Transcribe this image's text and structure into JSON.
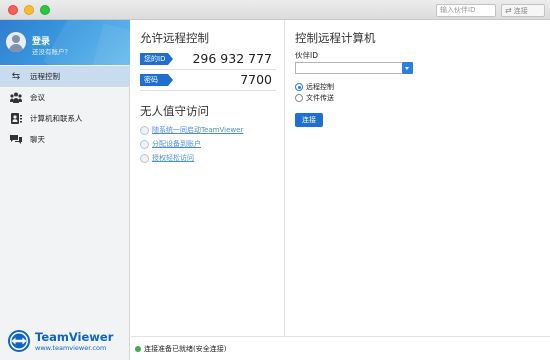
{
  "titlebar": {
    "partner_placeholder": "输入伙伴ID",
    "connect_label": "连接"
  },
  "sidebar": {
    "login_title": "登录",
    "login_subtitle": "还没有账户？",
    "items": [
      {
        "label": "远程控制",
        "icon": "arrows-icon",
        "active": true
      },
      {
        "label": "会议",
        "icon": "meeting-icon",
        "active": false
      },
      {
        "label": "计算机和联系人",
        "icon": "contacts-icon",
        "active": false
      },
      {
        "label": "聊天",
        "icon": "chat-icon",
        "active": false
      }
    ],
    "brand_name": "TeamViewer",
    "brand_url": "www.teamviewer.com"
  },
  "allow": {
    "title": "允许远程控制",
    "id_label": "您的ID",
    "id_value": "296 932 777",
    "pw_label": "密码",
    "pw_value": "7700"
  },
  "unattended": {
    "title": "无人值守访问",
    "links": [
      "随系统一同启动TeamViewer",
      "分配设备到账户",
      "授权轻松访问"
    ]
  },
  "control": {
    "title": "控制远程计算机",
    "partner_label": "伙伴ID",
    "partner_value": "",
    "options": [
      "远程控制",
      "文件传送"
    ],
    "selected_option": "远程控制",
    "connect_label": "连接"
  },
  "status": {
    "text": "连接准备已就绪(安全连接)",
    "color": "#37b24d"
  },
  "colors": {
    "accent": "#1e6fd0",
    "sidebar_active": "#c9dcef"
  }
}
